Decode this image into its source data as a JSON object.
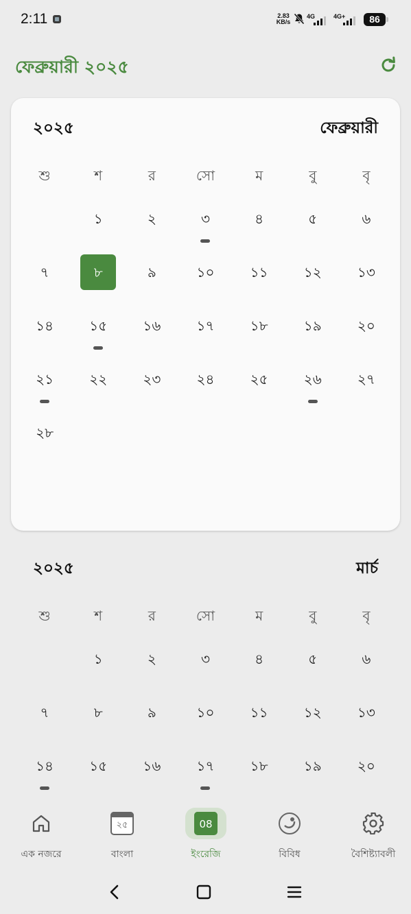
{
  "status_bar": {
    "time": "2:11",
    "net_speed_value": "2.83",
    "net_speed_unit": "KB/s",
    "signal1_label": "4G",
    "signal2_label": "4G+",
    "battery": "86"
  },
  "header": {
    "title": "ফেব্রুয়ারী ২০২৫"
  },
  "weekdays": [
    "শু",
    "শ",
    "র",
    "সো",
    "ম",
    "বু",
    "বৃ"
  ],
  "months": [
    {
      "year": "২০২৫",
      "name": "ফেব্রুয়ারী",
      "leading_blanks": 1,
      "days": [
        "১",
        "২",
        "৩",
        "৪",
        "৫",
        "৬",
        "৭",
        "৮",
        "৯",
        "১০",
        "১১",
        "১২",
        "১৩",
        "১৪",
        "১৫",
        "১৬",
        "১৭",
        "১৮",
        "১৯",
        "২০",
        "২১",
        "২২",
        "২৩",
        "২৪",
        "২৫",
        "২৬",
        "২৭",
        "২৮"
      ],
      "today_index": 7,
      "event_indices": [
        2,
        14,
        20,
        25
      ]
    },
    {
      "year": "২০২৫",
      "name": "মার্চ",
      "leading_blanks": 1,
      "days": [
        "১",
        "২",
        "৩",
        "৪",
        "৫",
        "৬",
        "৭",
        "৮",
        "৯",
        "১০",
        "১১",
        "১২",
        "১৩",
        "১৪",
        "১৫",
        "১৬",
        "১৭",
        "১৮",
        "১৯",
        "২০"
      ],
      "today_index": -1,
      "event_indices": [
        13,
        16
      ]
    }
  ],
  "bottom_nav": {
    "items": [
      {
        "label": "এক নজরে",
        "icon": "home-icon"
      },
      {
        "label": "বাংলা",
        "icon": "calendar-icon",
        "icon_text": "২৫"
      },
      {
        "label": "ইংরেজি",
        "icon": "calendar-icon",
        "icon_text": "08",
        "active": true
      },
      {
        "label": "বিবিধ",
        "icon": "misc-icon"
      },
      {
        "label": "বৈশিষ্ট্যাবলী",
        "icon": "gear-icon"
      }
    ]
  },
  "colors": {
    "accent": "#4a8a3f",
    "accent_light": "#d4e1cf",
    "background": "#ececec",
    "card": "#fafafa"
  }
}
